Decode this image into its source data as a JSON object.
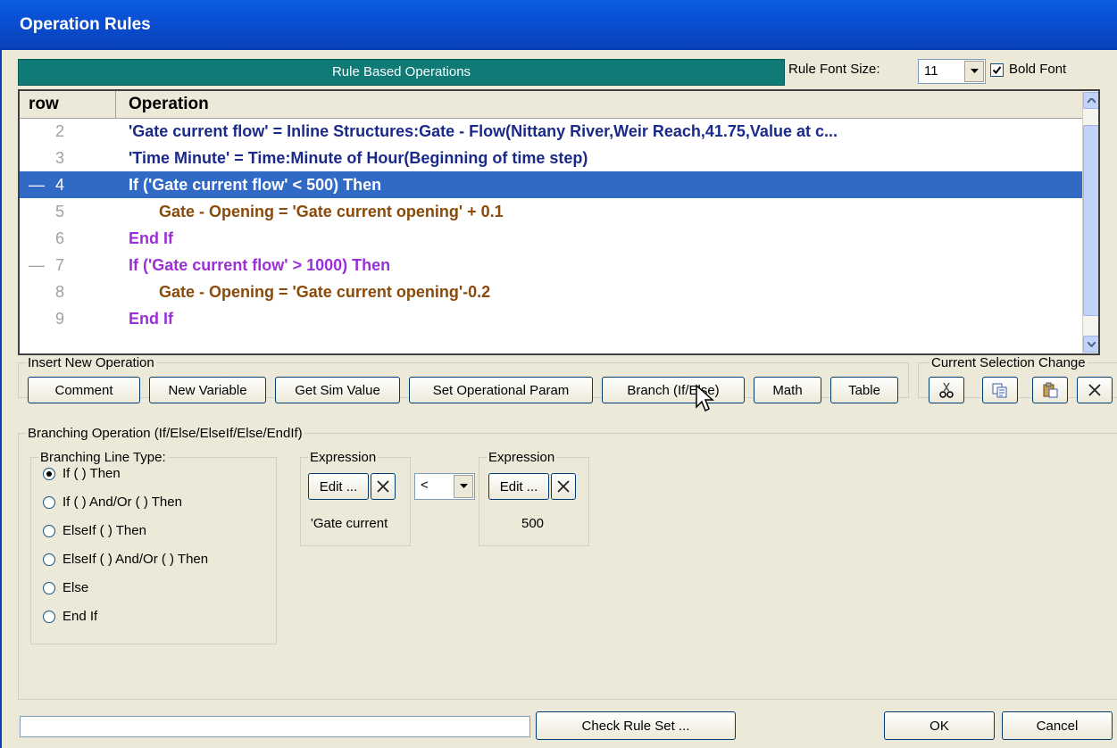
{
  "window": {
    "title": "Operation Rules"
  },
  "header": {
    "banner": "Rule Based Operations",
    "font_size_label": "Rule Font Size:",
    "font_size_value": "11",
    "bold_font_label": "Bold Font",
    "bold_font_checked": true
  },
  "grid": {
    "col_row": "row",
    "col_operation": "Operation",
    "rows": [
      {
        "num": "2",
        "text": "'Gate current flow' = Inline Structures:Gate - Flow(Nittany River,Weir Reach,41.75,Value at c...",
        "color": "#1a2a8a",
        "indent": 0,
        "marker": ""
      },
      {
        "num": "3",
        "text": "'Time Minute' = Time:Minute of Hour(Beginning of time step)",
        "color": "#1a2a8a",
        "indent": 0,
        "marker": ""
      },
      {
        "num": "4",
        "text": "If ('Gate current flow' < 500) Then",
        "color": "#9b30d9",
        "indent": 0,
        "marker": "—",
        "selected": true
      },
      {
        "num": "5",
        "text": "Gate - Opening = 'Gate current opening' + 0.1",
        "color": "#8a4a0a",
        "indent": 1,
        "marker": ""
      },
      {
        "num": "6",
        "text": "End If",
        "color": "#9b30d9",
        "indent": 0,
        "marker": ""
      },
      {
        "num": "7",
        "text": "If ('Gate current flow' > 1000) Then",
        "color": "#9b30d9",
        "indent": 0,
        "marker": "—"
      },
      {
        "num": "8",
        "text": "Gate - Opening = 'Gate current opening'-0.2",
        "color": "#8a4a0a",
        "indent": 1,
        "marker": ""
      },
      {
        "num": "9",
        "text": "End If",
        "color": "#9b30d9",
        "indent": 0,
        "marker": ""
      }
    ]
  },
  "insert": {
    "legend": "Insert New Operation",
    "buttons": [
      "Comment",
      "New Variable",
      "Get Sim Value",
      "Set Operational Param",
      "Branch (If/Else)",
      "Math",
      "Table"
    ]
  },
  "selection": {
    "legend": "Current Selection Change"
  },
  "branching": {
    "legend": "Branching Operation (If/Else/ElseIf/Else/EndIf)",
    "line_type_legend": "Branching Line Type:",
    "options": [
      "If ( ) Then",
      "If ( ) And/Or ( ) Then",
      "ElseIf ( ) Then",
      "ElseIf ( ) And/Or ( ) Then",
      "Else",
      "End If"
    ],
    "selected_index": 0,
    "expr1": {
      "legend": "Expression",
      "edit_label": "Edit ...",
      "value": "'Gate current"
    },
    "operator": "<",
    "expr2": {
      "legend": "Expression",
      "edit_label": "Edit ...",
      "value": "500"
    }
  },
  "footer": {
    "check_label": "Check Rule Set ...",
    "ok_label": "OK",
    "cancel_label": "Cancel"
  }
}
